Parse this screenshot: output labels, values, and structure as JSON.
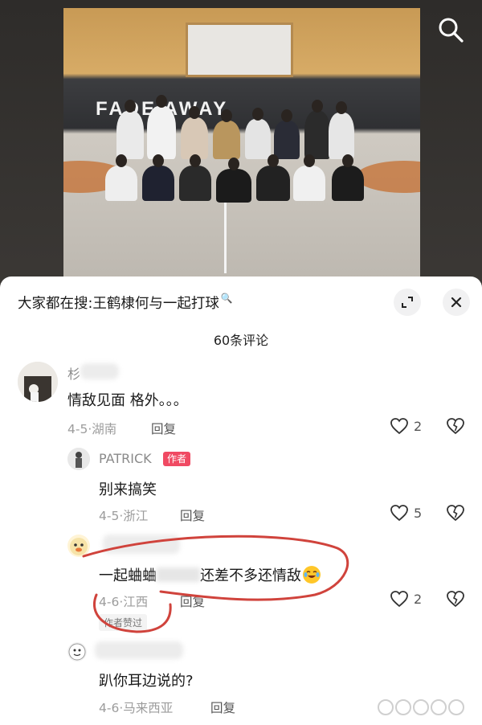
{
  "header": {
    "search_icon": "search-icon"
  },
  "panel": {
    "search_prefix": "大家都在搜:",
    "search_query": "王鹤棣何与一起打球",
    "search_query_icon": "🔍",
    "comment_count": "60条评论"
  },
  "photo": {
    "banner_text": "FADE  AWAY"
  },
  "comments": [
    {
      "username": "杉",
      "text": "情敌见面 格外。。。",
      "date": "4-5·湖南",
      "reply_label": "回复",
      "likes": "2"
    },
    {
      "username": "PATRICK",
      "author_tag": "作者",
      "text": "别来搞笑",
      "date": "4-5·浙江",
      "reply_label": "回复",
      "likes": "5"
    },
    {
      "text_before": "一起蛐蛐",
      "text_after": "还差不多还情敌",
      "date": "4-6·江西",
      "reply_label": "回复",
      "likes": "2",
      "author_liked": "作者赞过"
    },
    {
      "text": "趴你耳边说的?",
      "date": "4-6·马来西亚",
      "reply_label": "回复"
    }
  ],
  "colors": {
    "author_tag": "#f04a63",
    "annotation_circle": "#d0433c"
  }
}
